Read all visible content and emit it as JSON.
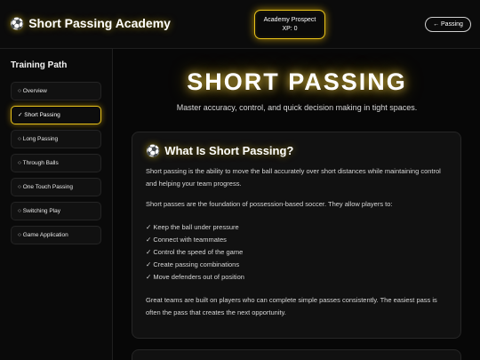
{
  "header": {
    "brand_icon": "soccer-ball-icon",
    "brand_title": "Short Passing Academy",
    "prospect_rank": "Academy Prospect",
    "prospect_xp": "XP: 0",
    "back_button": "← Passing"
  },
  "sidebar": {
    "title": "Training Path",
    "items": [
      {
        "label": "○ Overview",
        "active": false
      },
      {
        "label": "✓ Short Passing",
        "active": true
      },
      {
        "label": "○ Long Passing",
        "active": false
      },
      {
        "label": "○ Through Balls",
        "active": false
      },
      {
        "label": "○ One Touch Passing",
        "active": false
      },
      {
        "label": "○ Switching Play",
        "active": false
      },
      {
        "label": "○ Game Application",
        "active": false
      }
    ]
  },
  "main": {
    "hero_title": "SHORT PASSING",
    "hero_subtitle": "Master accuracy, control, and quick decision making in tight spaces.",
    "card": {
      "icon": "soccer-ball-icon",
      "title": "What Is Short Passing?",
      "paragraph1": "Short passing is the ability to move the ball accurately over short distances while maintaining control and helping your team progress.",
      "paragraph2": "Short passes are the foundation of possession-based soccer. They allow players to:",
      "bullets": [
        "✓ Keep the ball under pressure",
        "✓ Connect with teammates",
        "✓ Control the speed of the game",
        "✓ Create passing combinations",
        "✓ Move defenders out of position"
      ],
      "paragraph3": "Great teams are built on players who can complete simple passes consistently. The easiest pass is often the pass that creates the next opportunity."
    }
  },
  "colors": {
    "accent": "#e8c21a",
    "background": "#070707",
    "card": "#111111"
  }
}
